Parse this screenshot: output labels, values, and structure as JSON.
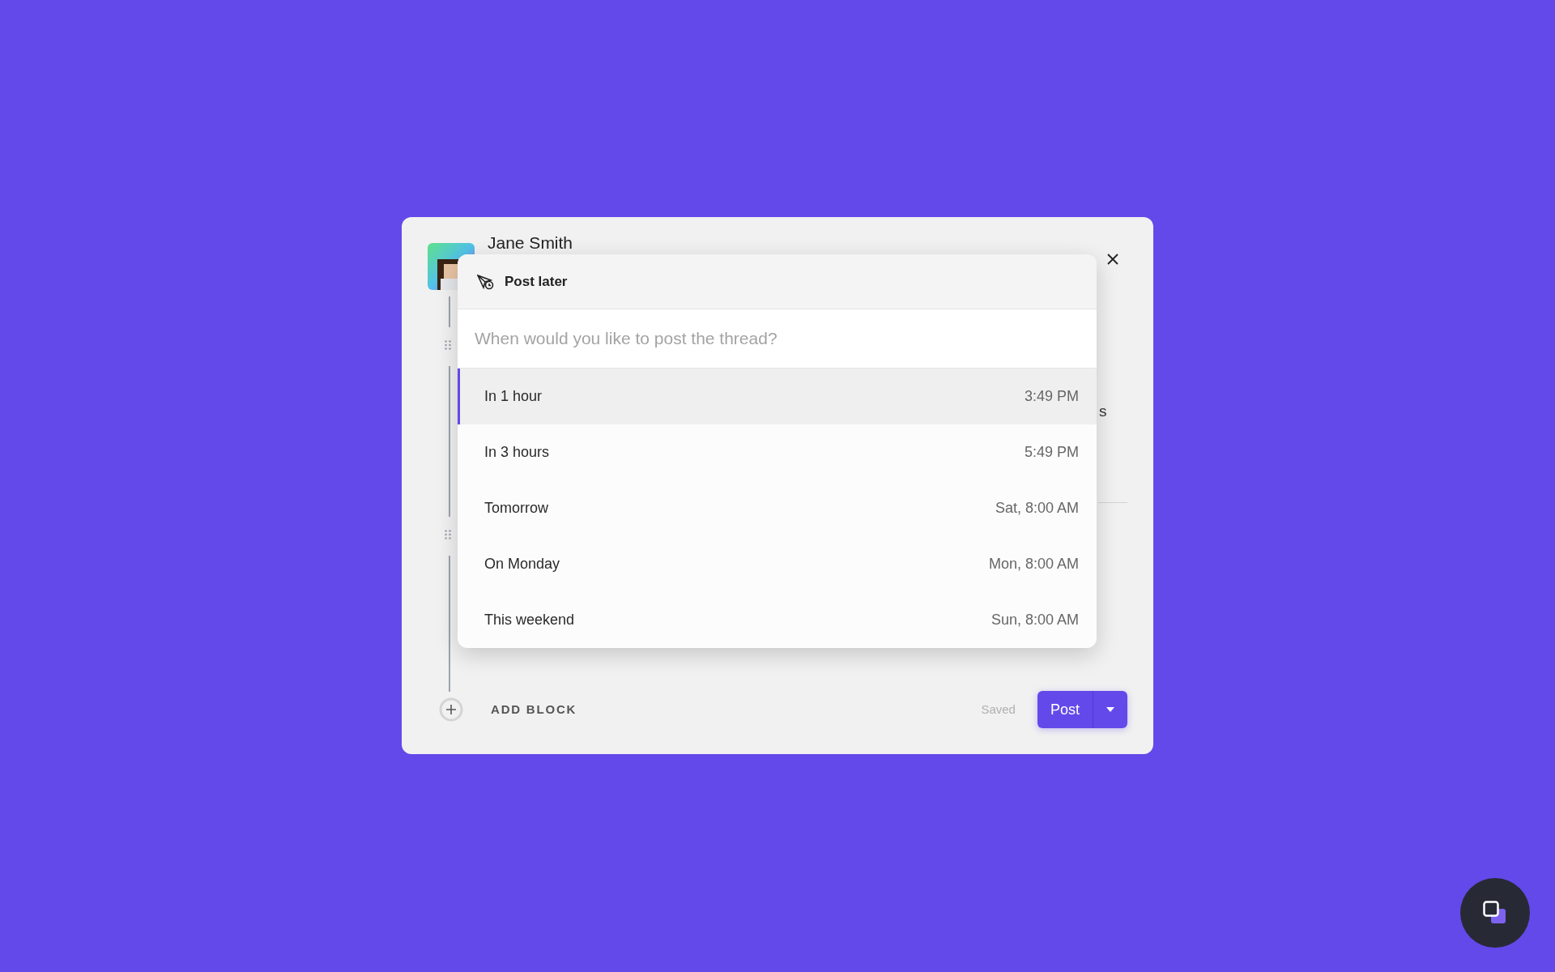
{
  "author": {
    "name": "Jane Smith"
  },
  "partial_text": "s",
  "popover": {
    "title": "Post later",
    "search": {
      "placeholder": "When would you like to post the thread?"
    },
    "options": [
      {
        "label": "In 1 hour",
        "time": "3:49 PM",
        "selected": true
      },
      {
        "label": "In 3 hours",
        "time": "5:49 PM",
        "selected": false
      },
      {
        "label": "Tomorrow",
        "time": "Sat, 8:00 AM",
        "selected": false
      },
      {
        "label": "On Monday",
        "time": "Mon, 8:00 AM",
        "selected": false
      },
      {
        "label": "This weekend",
        "time": "Sun, 8:00 AM",
        "selected": false
      }
    ]
  },
  "footer": {
    "add_block": "ADD BLOCK",
    "status": "Saved",
    "post_button": "Post"
  }
}
